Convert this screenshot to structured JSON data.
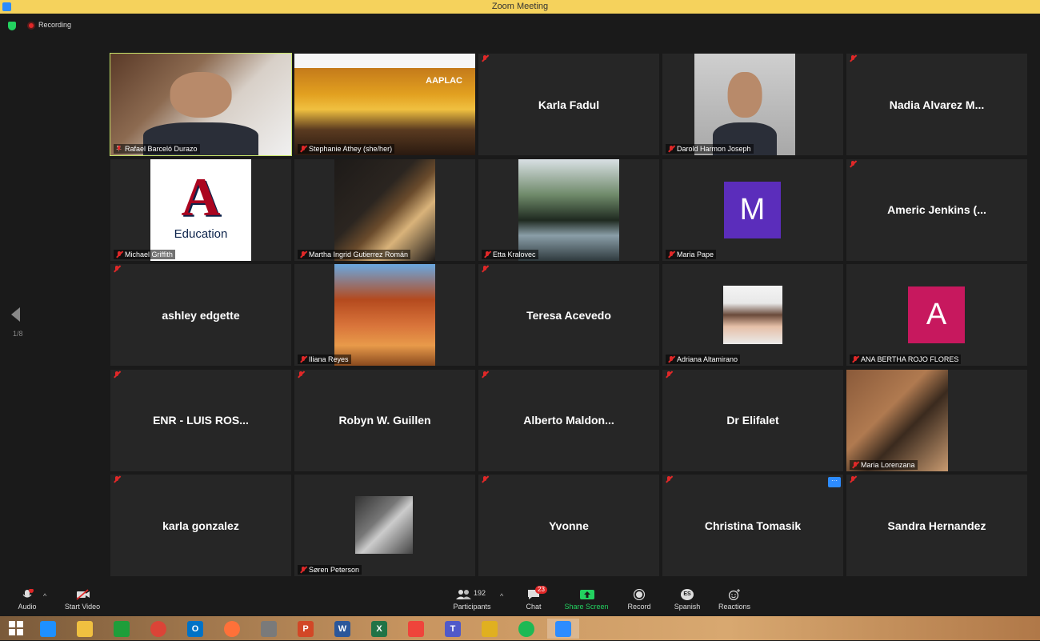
{
  "window": {
    "title": "Zoom Meeting"
  },
  "status": {
    "recording_label": "Recording"
  },
  "pager": {
    "page": "1/8"
  },
  "tiles": [
    {
      "name": "Rafael Barceló Durazo",
      "type": "video",
      "active": true
    },
    {
      "name": "Stephanie Athey  (she/her)",
      "type": "screen",
      "screen_heading": "AAPLAC"
    },
    {
      "name": "Karla Fadul",
      "type": "name"
    },
    {
      "name": "Darold Harmon Joseph",
      "type": "photo"
    },
    {
      "name": "Nadia Alvarez M...",
      "type": "name"
    },
    {
      "name": "Michael Griffith",
      "type": "logo",
      "logo_letter": "A",
      "logo_text": "Education"
    },
    {
      "name": "Martha Ingrid Gutierrez Román",
      "type": "photo"
    },
    {
      "name": "Etta Kralovec",
      "type": "photo"
    },
    {
      "name": "Maria Pape",
      "type": "avatar",
      "letter": "M",
      "color": "#5b2dbb"
    },
    {
      "name": "Americ Jenkins (...",
      "type": "name"
    },
    {
      "name": "ashley edgette",
      "type": "name"
    },
    {
      "name": "Iliana Reyes",
      "type": "photo"
    },
    {
      "name": "Teresa Acevedo",
      "type": "name"
    },
    {
      "name": "Adriana Altamirano",
      "type": "photo"
    },
    {
      "name": "ANA BERTHA ROJO FLORES",
      "type": "avatar",
      "letter": "A",
      "color": "#c7185e"
    },
    {
      "name": "ENR - LUIS ROS...",
      "type": "name"
    },
    {
      "name": "Robyn W. Guillen",
      "type": "name"
    },
    {
      "name": "Alberto  Maldon...",
      "type": "name"
    },
    {
      "name": "Dr Elifalet",
      "type": "name"
    },
    {
      "name": "Maria Lorenzana",
      "type": "photo"
    },
    {
      "name": "karla gonzalez",
      "type": "name"
    },
    {
      "name": "Søren Peterson",
      "type": "photo"
    },
    {
      "name": "Yvonne",
      "type": "name"
    },
    {
      "name": "Christina Tomasik",
      "type": "name",
      "more": "···"
    },
    {
      "name": "Sandra Hernandez",
      "type": "name"
    }
  ],
  "toolbar": {
    "audio": "Audio",
    "video": "Start Video",
    "participants": "Participants",
    "participants_count": "192",
    "chat": "Chat",
    "chat_badge": "23",
    "share": "Share Screen",
    "record": "Record",
    "language": "Spanish",
    "language_code": "ES",
    "reactions": "Reactions"
  },
  "colors": {
    "titlebar": "#f5d25c",
    "active_outline": "#c7e36a",
    "share_green": "#23d160",
    "accent": "#2d8cff",
    "mute_red": "#e02828"
  },
  "taskbar": [
    {
      "icon": "windows-start-icon"
    },
    {
      "icon": "internet-explorer-icon"
    },
    {
      "icon": "file-explorer-icon"
    },
    {
      "icon": "store-icon"
    },
    {
      "icon": "chrome-icon"
    },
    {
      "icon": "outlook-icon",
      "text": "O"
    },
    {
      "icon": "firefox-icon"
    },
    {
      "icon": "calculator-icon"
    },
    {
      "icon": "powerpoint-icon",
      "text": "P"
    },
    {
      "icon": "word-icon",
      "text": "W"
    },
    {
      "icon": "excel-icon",
      "text": "X"
    },
    {
      "icon": "anydesk-icon"
    },
    {
      "icon": "teams-icon",
      "text": "T"
    },
    {
      "icon": "app-icon"
    },
    {
      "icon": "spotify-icon"
    },
    {
      "icon": "zoom-icon"
    }
  ]
}
